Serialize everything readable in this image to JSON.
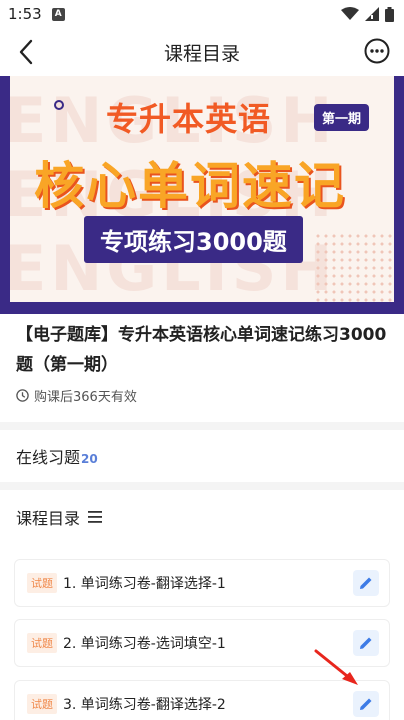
{
  "status_bar": {
    "time": "1:53",
    "notification_letter": "A"
  },
  "nav": {
    "title": "课程目录"
  },
  "banner": {
    "top_text": "专升本英语",
    "badge": "第一期",
    "main_text": "核心单词速记",
    "sub_text": "专项练习3000题",
    "bg_word": "ENGLISH"
  },
  "course": {
    "title": "【电子题库】专升本英语核心单词速记练习3000题（第一期）",
    "validity": "购课后366天有效"
  },
  "exercises": {
    "label": "在线习题",
    "count": "20"
  },
  "catalog": {
    "label": "课程目录"
  },
  "lessons": [
    {
      "tag": "试题",
      "name": "1. 单词练习卷-翻译选择-1"
    },
    {
      "tag": "试题",
      "name": "2. 单词练习卷-选词填空-1"
    },
    {
      "tag": "试题",
      "name": "3. 单词练习卷-翻译选择-2"
    }
  ],
  "colors": {
    "accent": "#3a2a86",
    "orange": "#f15a24",
    "yellow": "#f9a526",
    "edit_icon": "#3d7be6",
    "annotation": "#e8261d"
  }
}
